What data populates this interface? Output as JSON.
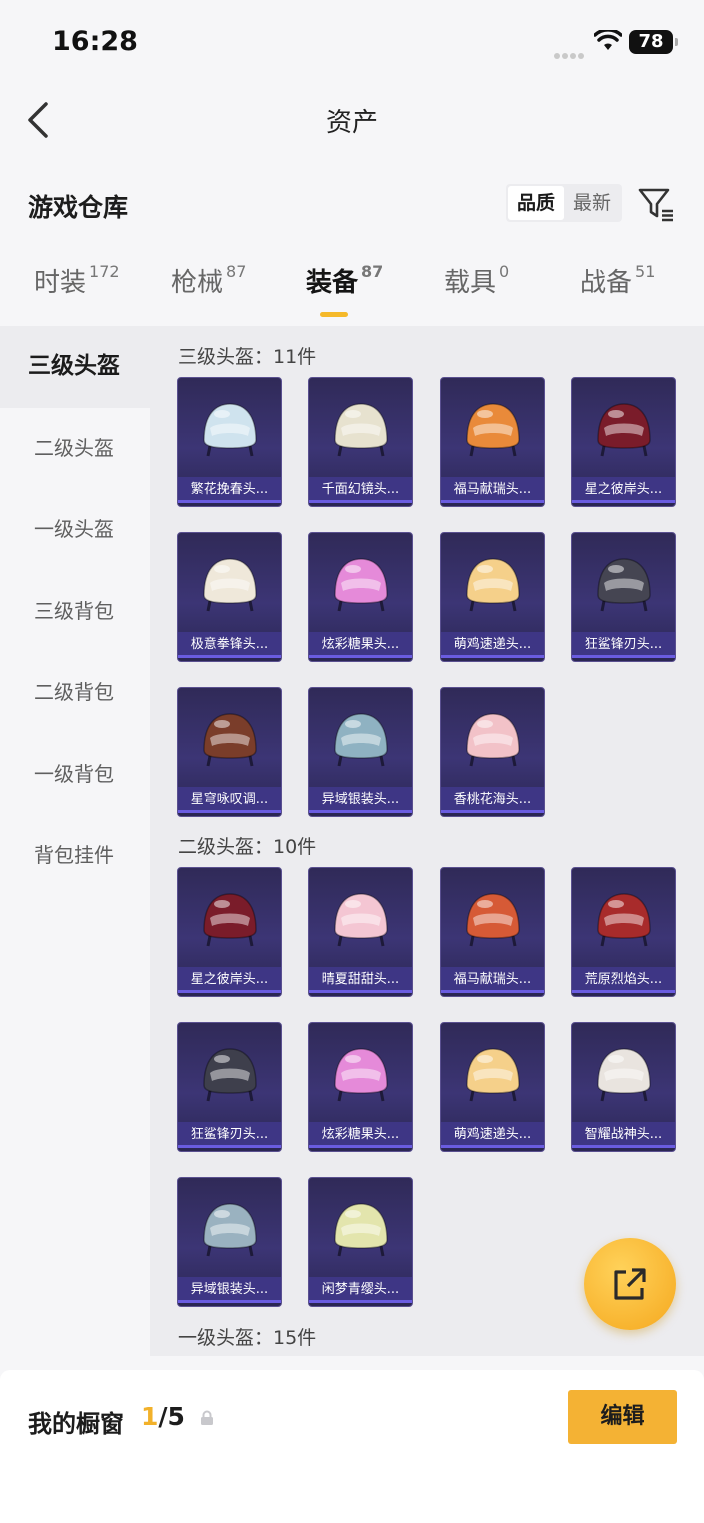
{
  "status": {
    "time": "16:28",
    "battery": "78"
  },
  "nav": {
    "title": "资产"
  },
  "header": {
    "title": "游戏仓库",
    "sort_options": [
      "品质",
      "最新"
    ]
  },
  "tabs": [
    {
      "label": "时装",
      "count": "172"
    },
    {
      "label": "枪械",
      "count": "87"
    },
    {
      "label": "装备",
      "count": "87"
    },
    {
      "label": "载具",
      "count": "0"
    },
    {
      "label": "战备",
      "count": "51"
    }
  ],
  "side_menu": [
    "三级头盔",
    "二级头盔",
    "一级头盔",
    "三级背包",
    "二级背包",
    "一级背包",
    "背包挂件"
  ],
  "sections": [
    {
      "title": "三级头盔：11件",
      "items": [
        {
          "name": "繁花挽春头...",
          "color": "#cfe3ee"
        },
        {
          "name": "千面幻镜头...",
          "color": "#e7e2cf"
        },
        {
          "name": "福马献瑞头...",
          "color": "#e98a3a"
        },
        {
          "name": "星之彼岸头...",
          "color": "#7a1c2a"
        },
        {
          "name": "极意拳锋头...",
          "color": "#efe8da"
        },
        {
          "name": "炫彩糖果头...",
          "color": "#e58ad9"
        },
        {
          "name": "萌鸡速递头...",
          "color": "#f5d08a"
        },
        {
          "name": "狂鲨锋刃头...",
          "color": "#454552"
        },
        {
          "name": "星穹咏叹调...",
          "color": "#7a3d2a"
        },
        {
          "name": "异域银装头...",
          "color": "#8fb2c2"
        },
        {
          "name": "香桃花海头...",
          "color": "#f2c2c8"
        }
      ]
    },
    {
      "title": "二级头盔：10件",
      "items": [
        {
          "name": "星之彼岸头...",
          "color": "#7a1c2a"
        },
        {
          "name": "晴夏甜甜头...",
          "color": "#f4c6d3"
        },
        {
          "name": "福马献瑞头...",
          "color": "#d65a36"
        },
        {
          "name": "荒原烈焰头...",
          "color": "#a82b2b"
        },
        {
          "name": "狂鲨锋刃头...",
          "color": "#3e3f4c"
        },
        {
          "name": "炫彩糖果头...",
          "color": "#e58ad9"
        },
        {
          "name": "萌鸡速递头...",
          "color": "#f5d08a"
        },
        {
          "name": "智耀战神头...",
          "color": "#e9e4df"
        },
        {
          "name": "异域银装头...",
          "color": "#9ab2c0"
        },
        {
          "name": "闲梦青缨头...",
          "color": "#e3e5ad"
        }
      ]
    },
    {
      "title": "一级头盔：15件",
      "items": []
    }
  ],
  "bottom": {
    "label": "我的橱窗",
    "current": "1",
    "total": "/5",
    "edit": "编辑"
  }
}
